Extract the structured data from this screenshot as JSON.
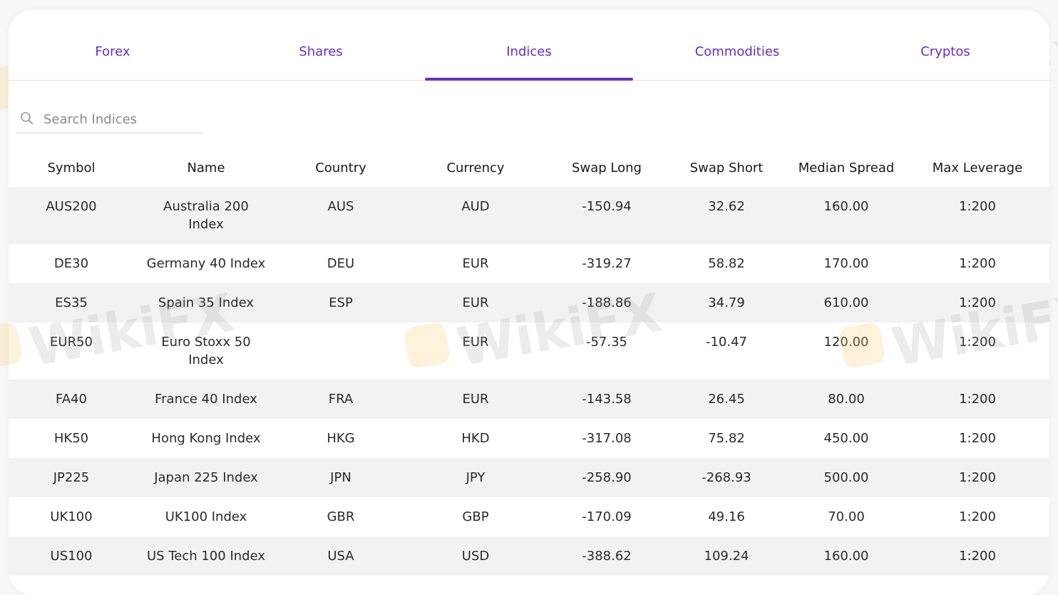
{
  "tabs": [
    {
      "label": "Forex"
    },
    {
      "label": "Shares"
    },
    {
      "label": "Indices"
    },
    {
      "label": "Commodities"
    },
    {
      "label": "Cryptos"
    }
  ],
  "active_tab": "Indices",
  "accent_color": "#6a2bc9",
  "search": {
    "placeholder": "Search Indices",
    "value": "",
    "icon": "search-icon"
  },
  "table": {
    "headers": [
      "Symbol",
      "Name",
      "Country",
      "Currency",
      "Swap Long",
      "Swap Short",
      "Median Spread",
      "Max Leverage"
    ],
    "rows": [
      [
        "AUS200",
        "Australia 200 Index",
        "AUS",
        "AUD",
        "-150.94",
        "32.62",
        "160.00",
        "1:200"
      ],
      [
        "DE30",
        "Germany 40 Index",
        "DEU",
        "EUR",
        "-319.27",
        "58.82",
        "170.00",
        "1:200"
      ],
      [
        "ES35",
        "Spain 35 Index",
        "ESP",
        "EUR",
        "-188.86",
        "34.79",
        "610.00",
        "1:200"
      ],
      [
        "EUR50",
        "Euro Stoxx 50 Index",
        "",
        "EUR",
        "-57.35",
        "-10.47",
        "120.00",
        "1:200"
      ],
      [
        "FA40",
        "France 40 Index",
        "FRA",
        "EUR",
        "-143.58",
        "26.45",
        "80.00",
        "1:200"
      ],
      [
        "HK50",
        "Hong Kong Index",
        "HKG",
        "HKD",
        "-317.08",
        "75.82",
        "450.00",
        "1:200"
      ],
      [
        "JP225",
        "Japan 225 Index",
        "JPN",
        "JPY",
        "-258.90",
        "-268.93",
        "500.00",
        "1:200"
      ],
      [
        "UK100",
        "UK100 Index",
        "GBR",
        "GBP",
        "-170.09",
        "49.16",
        "70.00",
        "1:200"
      ],
      [
        "US100",
        "US Tech 100 Index",
        "USA",
        "USD",
        "-388.62",
        "109.24",
        "160.00",
        "1:200"
      ]
    ]
  },
  "watermark_text": "WikiFX"
}
